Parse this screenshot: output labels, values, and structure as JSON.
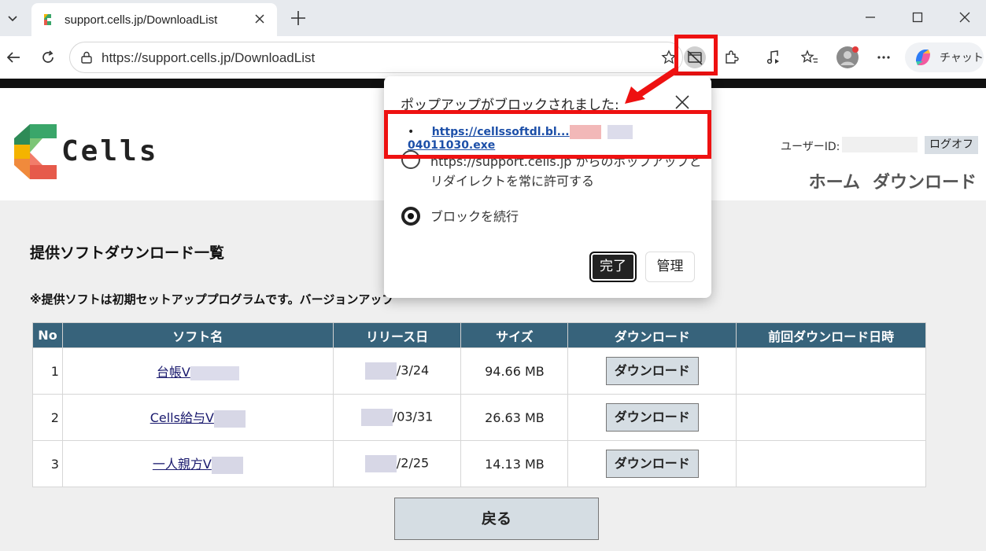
{
  "browser": {
    "tab_title": "support.cells.jp/DownloadList",
    "url": "https://support.cells.jp/DownloadList",
    "copilot_label": "チャット",
    "accent_red": "#ee1111"
  },
  "header": {
    "logo_text": "Cells",
    "user_id_label": "ユーザーID:",
    "logout_label": "ログオフ",
    "nav": [
      "ホーム",
      "ダウンロード"
    ]
  },
  "main": {
    "title": "提供ソフトダウンロード一覧",
    "notice": "※提供ソフトは初期セットアッププログラムです。バージョンアップ",
    "table": {
      "headers": [
        "No",
        "ソフト名",
        "リリース日",
        "サイズ",
        "ダウンロード",
        "前回ダウンロード日時"
      ],
      "rows": [
        {
          "no": "1",
          "name": "台帳V",
          "date": "/3/24",
          "size": "94.66 MB",
          "button": "ダウンロード",
          "last": ""
        },
        {
          "no": "2",
          "name": "Cells給与V",
          "date": "/03/31",
          "size": "26.63 MB",
          "button": "ダウンロード",
          "last": ""
        },
        {
          "no": "3",
          "name": "一人親方V",
          "date": "/2/25",
          "size": "14.13 MB",
          "button": "ダウンロード",
          "last": ""
        }
      ]
    },
    "back_label": "戻る"
  },
  "popup": {
    "title": "ポップアップがブロックされました:",
    "link_prefix": "https://cellssoftdl.bl...",
    "link_suffix": "04011030.exe",
    "option_allow_line1": "https://support.cells.jp からのポップアップと",
    "option_allow_line2": "リダイレクトを常に許可する",
    "option_block": "ブロックを続行",
    "done_label": "完了",
    "manage_label": "管理"
  }
}
